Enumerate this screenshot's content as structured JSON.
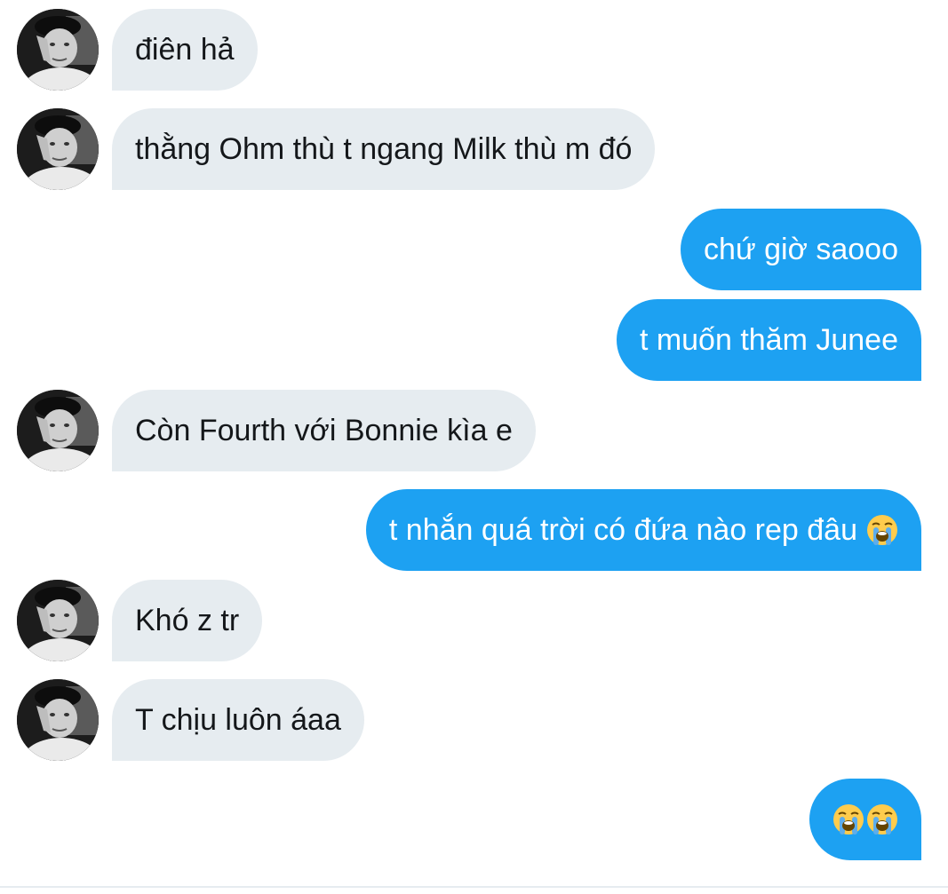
{
  "messages": [
    {
      "side": "in",
      "text": "điên hả"
    },
    {
      "side": "in",
      "text": "thằng Ohm thù t ngang Milk thù m đó"
    },
    {
      "side": "out",
      "text": "chứ giờ saooo"
    },
    {
      "side": "out",
      "text": "t muốn thăm Junee"
    },
    {
      "side": "in",
      "text": "Còn Fourth với Bonnie kìa e"
    },
    {
      "side": "out",
      "text": "t nhắn quá trời có đứa nào rep đâu",
      "emoji": "loudly-crying-face"
    },
    {
      "side": "in",
      "text": "Khó z tr"
    },
    {
      "side": "in",
      "text": "T chịu luôn áaa"
    },
    {
      "side": "out",
      "emoji_only": [
        "loudly-crying-face",
        "loudly-crying-face"
      ]
    }
  ],
  "colors": {
    "incoming_bubble": "#e6ecf0",
    "outgoing_bubble": "#1da1f2",
    "incoming_text": "#14171a",
    "outgoing_text": "#ffffff"
  }
}
